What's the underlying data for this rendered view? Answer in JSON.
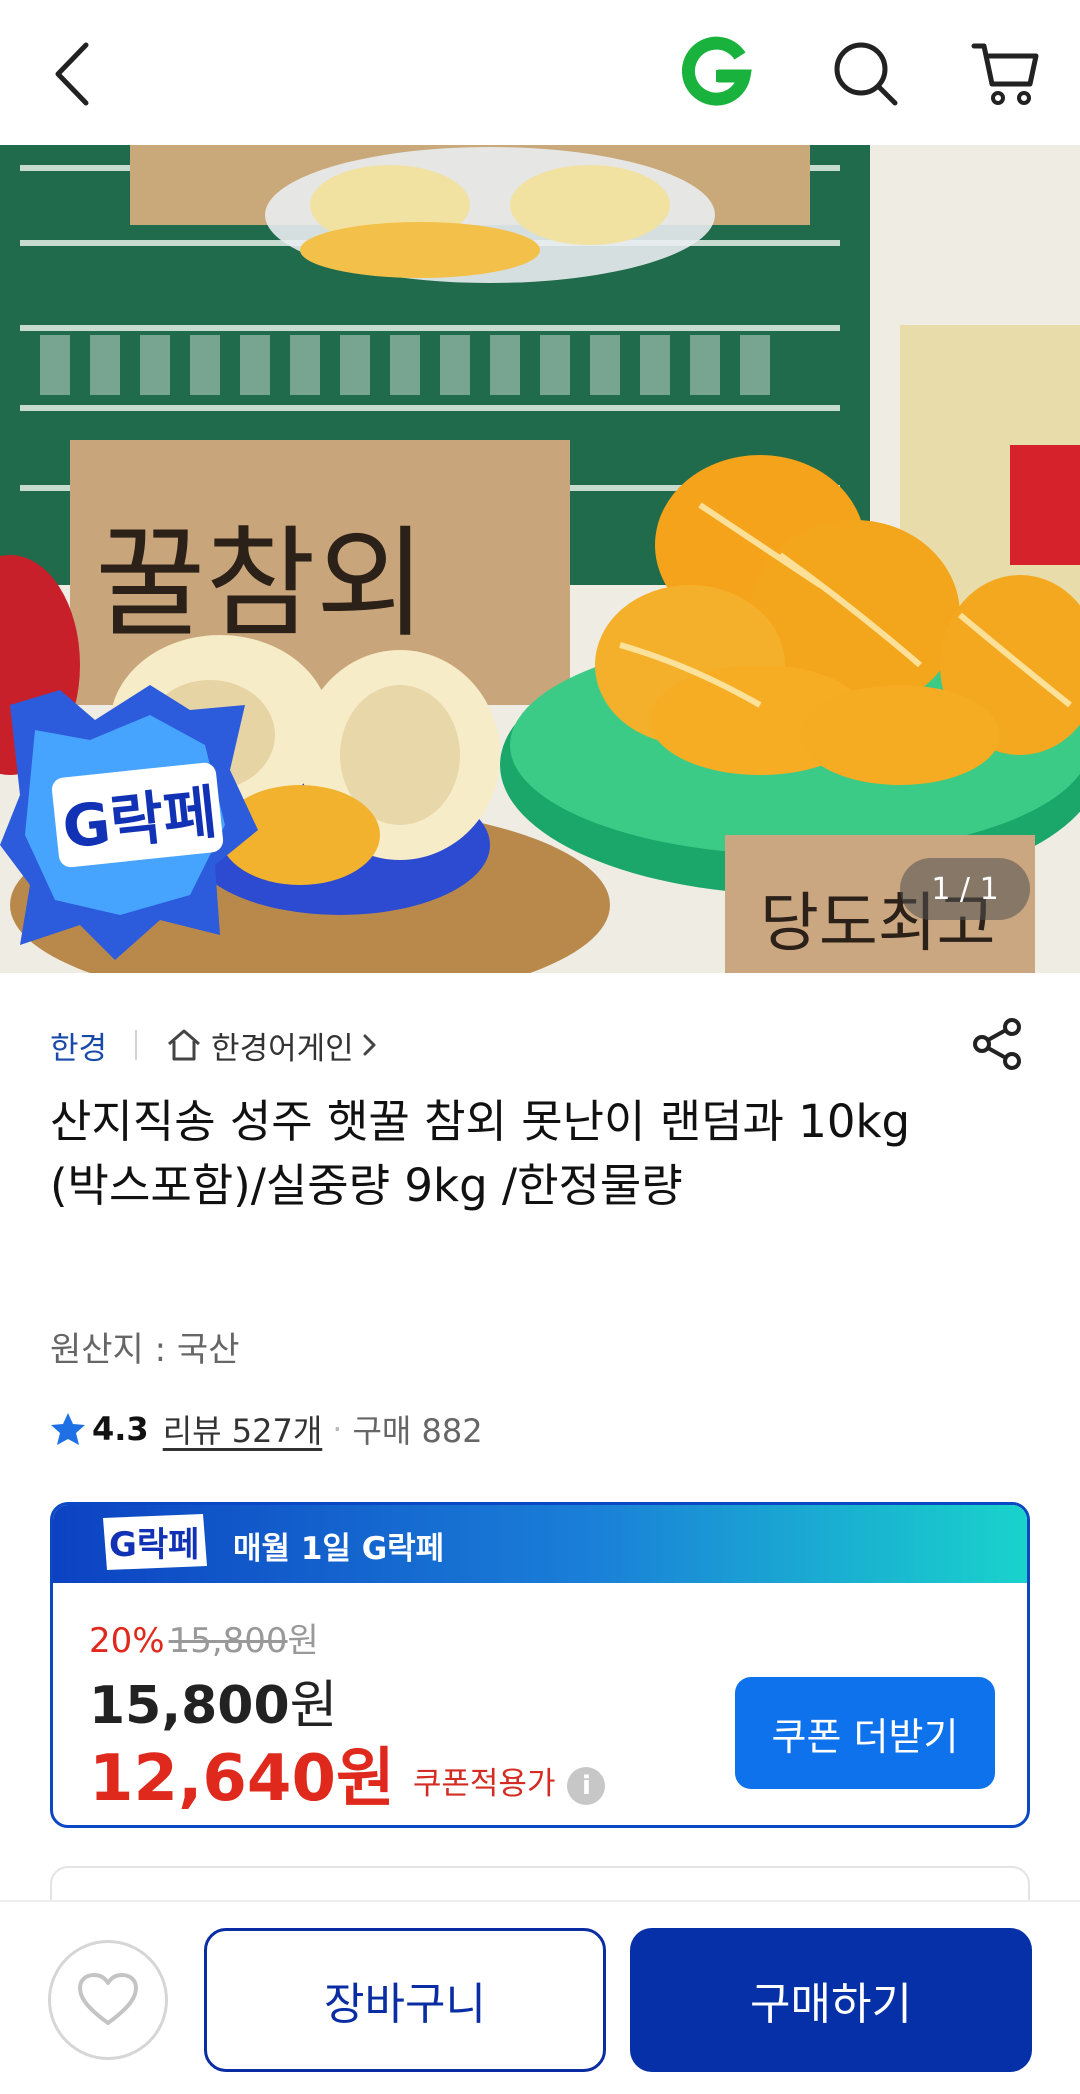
{
  "header": {
    "back_icon": "chevron-left-icon",
    "logo_letter": "G",
    "logo_color": "#19b23c",
    "search_icon": "search-icon",
    "cart_icon": "cart-icon"
  },
  "hero": {
    "image_counter": "1 / 1",
    "sign_text_main": "꿀참외",
    "sign_text_small": "당도최고",
    "badge_text": "G락페"
  },
  "product": {
    "brand": "한경",
    "store": "한경어게인",
    "title": "산지직송 성주 햇꿀 참외 못난이 랜덤과 10kg (박스포함)/실중량 9kg /한정물량",
    "origin": "원산지 : 국산",
    "rating": "4.3",
    "reviews": "리뷰 527개",
    "purchases": "구매 882"
  },
  "price": {
    "banner_text": "매월 1일 G락페",
    "badge_text": "G락페",
    "discount_pct": "20%",
    "original_price": "15,800",
    "original_unit": "원",
    "price": "15,800",
    "price_unit": "원",
    "coupon_price": "12,640원",
    "coupon_label": "쿠폰적용가",
    "info_symbol": "i",
    "coupon_button": "쿠폰 더받기"
  },
  "bottom_bar": {
    "wishlist_icon": "heart-icon",
    "cart_button": "장바구니",
    "buy_button": "구매하기"
  },
  "colors": {
    "brand_blue": "#0630a8",
    "accent_blue": "#0e72ec",
    "sale_red": "#e0291d",
    "logo_green": "#19b23c"
  }
}
